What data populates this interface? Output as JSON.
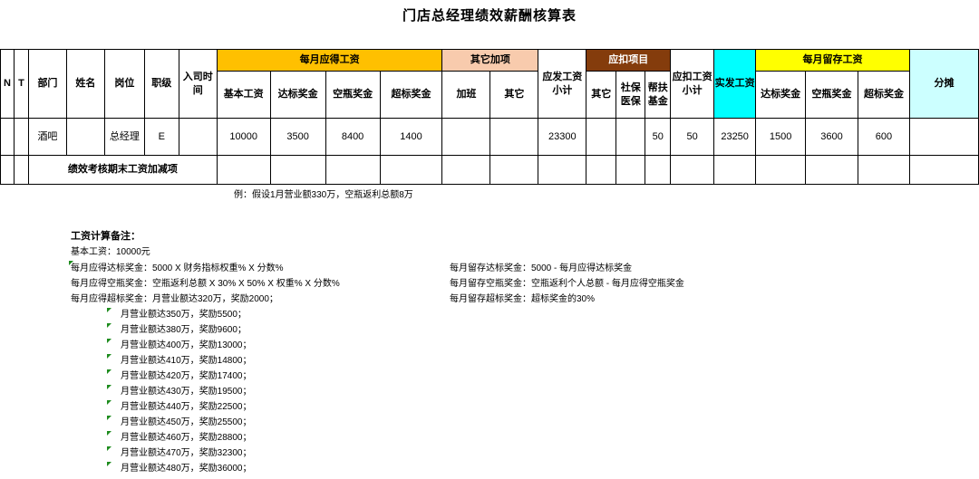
{
  "title": "门店总经理绩效薪酬核算表",
  "header": {
    "n": "N",
    "t": "T",
    "dept": "部门",
    "name": "姓名",
    "post": "岗位",
    "level": "职级",
    "join_date": "入司时间",
    "monthly_due": "每月应得工资",
    "base": "基本工资",
    "target_bonus": "达标奖金",
    "bottle_bonus": "空瓶奖金",
    "over_bonus": "超标奖金",
    "other_add": "其它加项",
    "overtime": "加班",
    "other1": "其它",
    "gross": "应发工资小计",
    "deduct": "应扣项目",
    "other2": "其它",
    "social": "社保医保",
    "aid": "帮扶基金",
    "deduct_total": "应扣工资小计",
    "actual": "实发工资",
    "retain": "每月留存工资",
    "r_target": "达标奖金",
    "r_bottle": "空瓶奖金",
    "r_over": "超标奖金",
    "share": "分摊"
  },
  "row1": {
    "dept": "酒吧",
    "post": "总经理",
    "level": "E",
    "base": "10000",
    "target_bonus": "3500",
    "bottle_bonus": "8400",
    "over_bonus": "1400",
    "gross": "23300",
    "aid": "50",
    "deduct_total": "50",
    "actual": "23250",
    "r_target": "1500",
    "r_bottle": "3600",
    "r_over": "600"
  },
  "row2": {
    "label": "绩效考核期末工资加减项"
  },
  "example": "例：假设1月营业额330万，空瓶返利总额8万",
  "notes": {
    "title": "工资计算备注：",
    "left": [
      "基本工资：10000元",
      "每月应得达标奖金：5000 X 财务指标权重% X 分数%",
      "每月应得空瓶奖金：空瓶返利总额 X 30% X 50% X 权重% X 分数%",
      "每月应得超标奖金：月营业额达320万，奖励2000；"
    ],
    "right": [
      "每月留存达标奖金：5000 - 每月应得达标奖金",
      "每月留存空瓶奖金：空瓶返利个人总额 - 每月应得空瓶奖金",
      "每月留存超标奖金：超标奖金的30%"
    ],
    "tiers": [
      "月营业额达350万，奖励5500；",
      "月营业额达380万，奖励9600；",
      "月营业额达400万，奖励13000；",
      "月营业额达410万，奖励14800；",
      "月营业额达420万，奖励17400；",
      "月营业额达430万，奖励19500；",
      "月营业额达440万，奖励22500；",
      "月营业额达450万，奖励25500；",
      "月营业额达460万，奖励28800；",
      "月营业额达470万，奖励32300；",
      "月营业额达480万，奖励36000；"
    ]
  }
}
